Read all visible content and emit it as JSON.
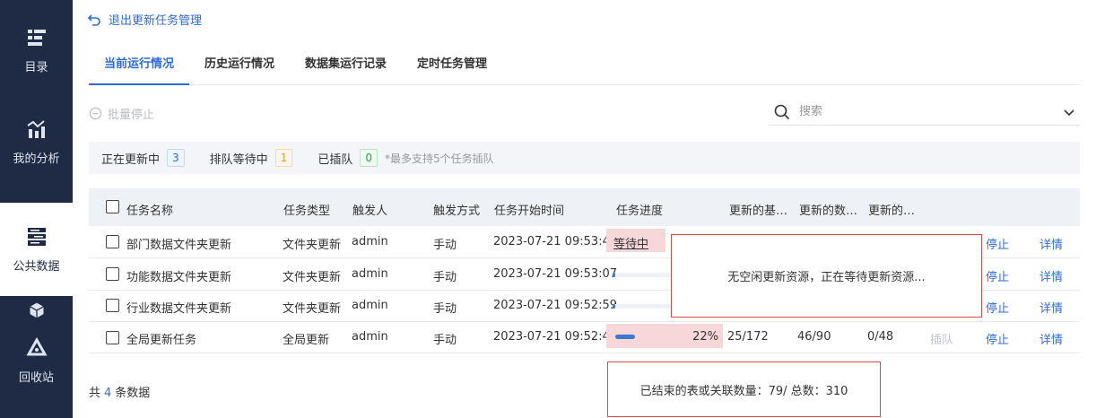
{
  "sidebar": {
    "items": [
      {
        "label": "目录",
        "icon": "catalog-icon"
      },
      {
        "label": "我的分析",
        "icon": "analysis-icon"
      },
      {
        "label": "公共数据",
        "icon": "public-data-icon"
      },
      {
        "label": "",
        "icon": "cube-icon"
      },
      {
        "label": "回收站",
        "icon": "recycle-icon"
      }
    ]
  },
  "back_label": "退出更新任务管理",
  "tabs": [
    "当前运行情况",
    "历史运行情况",
    "数据集运行记录",
    "定时任务管理"
  ],
  "batch_stop_label": "批量停止",
  "search": {
    "placeholder": "搜索"
  },
  "stats": {
    "updating_label": "正在更新中",
    "updating_count": "3",
    "queued_label": "排队等待中",
    "queued_count": "1",
    "jumped_label": "已插队",
    "jumped_count": "0",
    "note": "*最多支持5个任务插队"
  },
  "table": {
    "headers": [
      "任务名称",
      "任务类型",
      "触发人",
      "触发方式",
      "任务开始时间",
      "任务进度",
      "更新的基…",
      "更新的数…",
      "更新的…"
    ],
    "rows": [
      {
        "name": "部门数据文件夹更新",
        "type": "文件夹更新",
        "trigger_user": "admin",
        "trigger_mode": "手动",
        "start": "2023-07-21 09:53:41",
        "progress_text": "等待中",
        "progress": null,
        "c1": "",
        "c2": "",
        "c3": "",
        "jump": "",
        "stop": "停止",
        "detail": "详情"
      },
      {
        "name": "功能数据文件夹更新",
        "type": "文件夹更新",
        "trigger_user": "admin",
        "trigger_mode": "手动",
        "start": "2023-07-21 09:53:07",
        "progress_text": "",
        "progress": 0.02,
        "c1": "",
        "c2": "",
        "c3": "",
        "jump": "",
        "stop": "停止",
        "detail": "详情"
      },
      {
        "name": "行业数据文件夹更新",
        "type": "文件夹更新",
        "trigger_user": "admin",
        "trigger_mode": "手动",
        "start": "2023-07-21 09:52:59",
        "progress_text": "",
        "progress": 0.02,
        "c1": "",
        "c2": "",
        "c3": "",
        "jump": "",
        "stop": "停止",
        "detail": "详情"
      },
      {
        "name": "全局更新任务",
        "type": "全局更新",
        "trigger_user": "admin",
        "trigger_mode": "手动",
        "start": "2023-07-21 09:52:42",
        "progress_text": "22%",
        "progress": 0.22,
        "c1": "25/172",
        "c2": "46/90",
        "c3": "0/48",
        "jump": "插队",
        "stop": "停止",
        "detail": "详情"
      }
    ]
  },
  "tooltip_wait": "无空闲更新资源，正在等待更新资源...",
  "footer": {
    "prefix": "共",
    "count": "4",
    "suffix": "条数据"
  },
  "tooltip_end": "已结束的表或关联数量：79/ 总数：310",
  "colors": {
    "sidebar": "#1f2a44",
    "accent": "#2f6bd6",
    "highlight_border": "#e04848",
    "progress_highlight": "#f8d7d9"
  }
}
